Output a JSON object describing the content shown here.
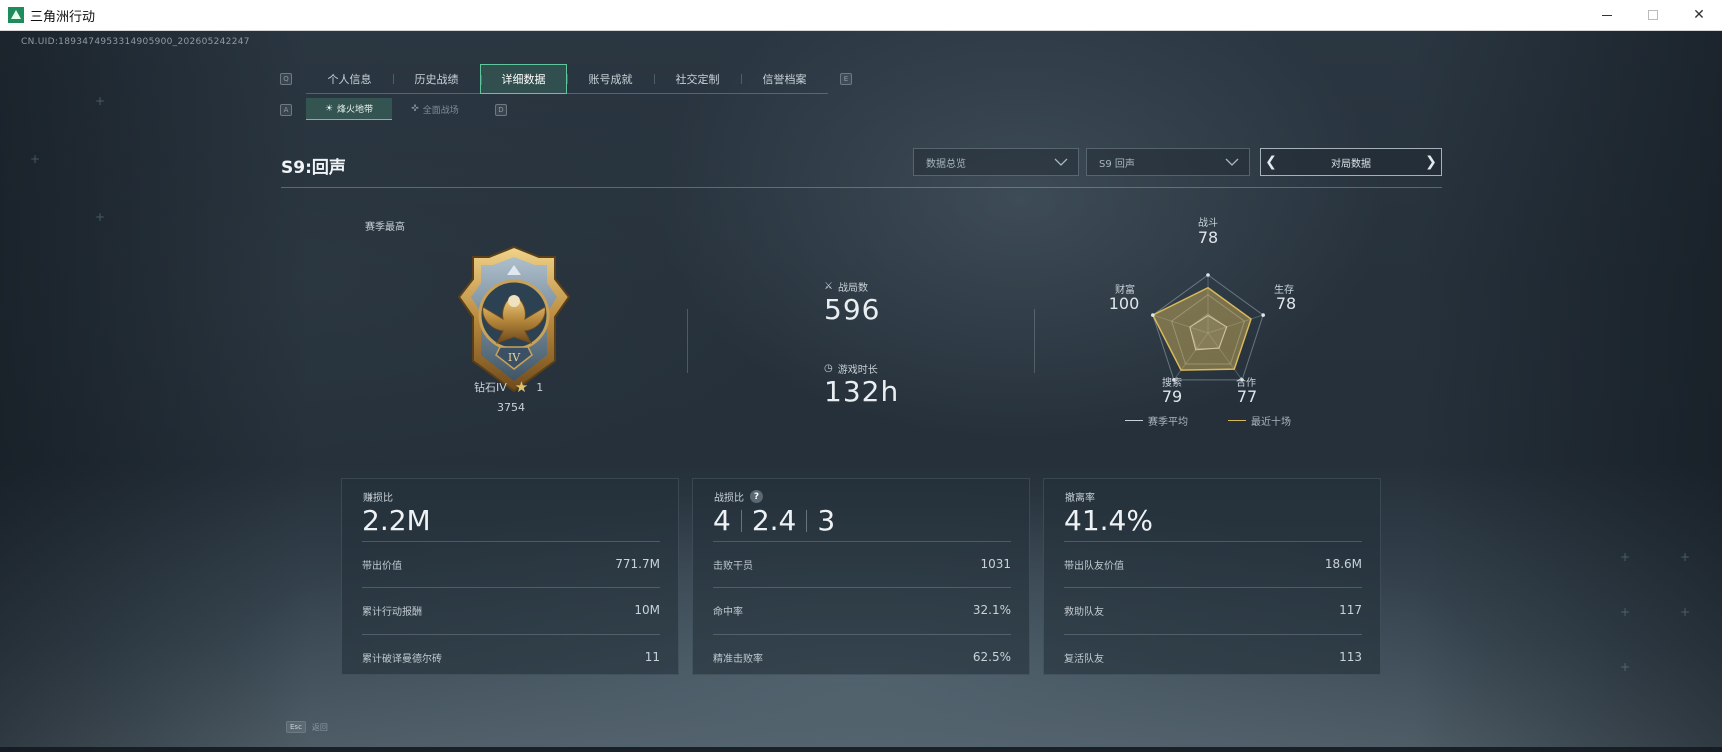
{
  "window": {
    "title": "三角洲行动",
    "minimize_glyph": "—",
    "maximize_glyph": "☐",
    "close_glyph": "✕"
  },
  "uid": "CN.UID:1893474953314905900_202605242247",
  "tabs": {
    "prev_key": "Q",
    "next_key": "E",
    "items": [
      {
        "label": "个人信息"
      },
      {
        "label": "历史战绩"
      },
      {
        "label": "详细数据",
        "active": true
      },
      {
        "label": "账号成就"
      },
      {
        "label": "社交定制"
      },
      {
        "label": "信誉档案"
      }
    ]
  },
  "sub_tabs": {
    "prev_key": "A",
    "next_key": "D",
    "items": [
      {
        "label": "烽火地带",
        "icon": "hazard-zone-icon",
        "active": true
      },
      {
        "label": "全面战场",
        "icon": "warfare-icon"
      }
    ]
  },
  "header": {
    "season_title": "S9:回声",
    "select_overview": "数据总览",
    "select_season": "S9 回声",
    "pager_label": "对局数据",
    "prev_arrow": "❮",
    "next_arrow": "❯"
  },
  "rank": {
    "season_best_label": "赛季最高",
    "tier": "钻石IV",
    "stars": "1",
    "points": "3754",
    "medal_numeral": "IV"
  },
  "stats": {
    "matches_label": "战局数",
    "matches_value": "596",
    "playtime_label": "游戏时长",
    "playtime_value": "132h"
  },
  "radar": {
    "axes": [
      {
        "label": "战斗",
        "value": "78"
      },
      {
        "label": "生存",
        "value": "78"
      },
      {
        "label": "合作",
        "value": "77"
      },
      {
        "label": "搜索",
        "value": "79"
      },
      {
        "label": "财富",
        "value": "100"
      }
    ],
    "season_avg_shape": [
      0.3,
      0.34,
      0.32,
      0.36,
      0.33
    ],
    "recent10_shape": [
      0.78,
      0.78,
      0.77,
      0.79,
      1.0
    ],
    "legend_season": "赛季平均",
    "legend_recent": "最近十场",
    "color_season": "#c9d2d8",
    "color_recent": "#d9b85a"
  },
  "cards": [
    {
      "title": "赚损比",
      "big": "2.2M",
      "rows": [
        {
          "label": "带出价值",
          "value": "771.7M"
        },
        {
          "label": "累计行动报酬",
          "value": "10M"
        },
        {
          "label": "累计破译曼德尔砖",
          "value": "11"
        }
      ]
    },
    {
      "title": "战损比",
      "help": "?",
      "big_parts": [
        "4",
        "2.4",
        "3"
      ],
      "rows": [
        {
          "label": "击败干员",
          "value": "1031"
        },
        {
          "label": "命中率",
          "value": "32.1%"
        },
        {
          "label": "精准击败率",
          "value": "62.5%"
        }
      ]
    },
    {
      "title": "撤离率",
      "big": "41.4%",
      "rows": [
        {
          "label": "带出队友价值",
          "value": "18.6M"
        },
        {
          "label": "救助队友",
          "value": "117"
        },
        {
          "label": "复活队友",
          "value": "113"
        }
      ]
    }
  ],
  "footer": {
    "esc_key": "Esc",
    "back_label": "返回"
  }
}
